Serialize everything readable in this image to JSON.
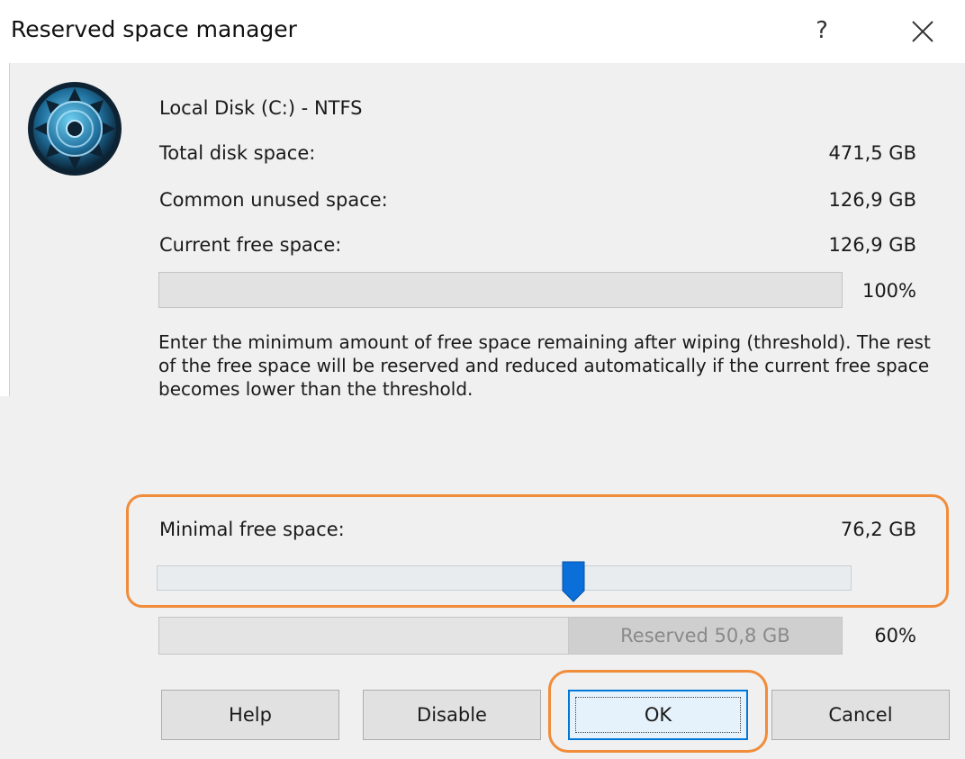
{
  "window": {
    "title": "Reserved space manager",
    "help_glyph": "?",
    "close_icon": "close-icon"
  },
  "disk": {
    "icon": "disk-wipe-icon",
    "name": "Local Disk (C:) - NTFS",
    "total_label": "Total disk space:",
    "total_value": "471,5 GB",
    "unused_label": "Common unused space:",
    "unused_value": "126,9 GB",
    "free_label": "Current free space:",
    "free_value": "126,9 GB",
    "free_percent_text": "100%",
    "free_percent": 100
  },
  "description": "Enter the minimum amount of free space remaining after wiping (threshold). The rest of the free space will be reserved and reduced automatically if the current free space becomes lower than the threshold.",
  "threshold": {
    "label": "Minimal free space:",
    "value": "76,2 GB",
    "slider_fraction": 0.6
  },
  "reserved": {
    "label": "Reserved 50,8 GB",
    "percent_text": "60%",
    "free_fraction": 0.6
  },
  "buttons": {
    "help": "Help",
    "disable": "Disable",
    "ok": "OK",
    "cancel": "Cancel"
  },
  "colors": {
    "highlight": "#f08c3a",
    "accent": "#0078d7"
  }
}
